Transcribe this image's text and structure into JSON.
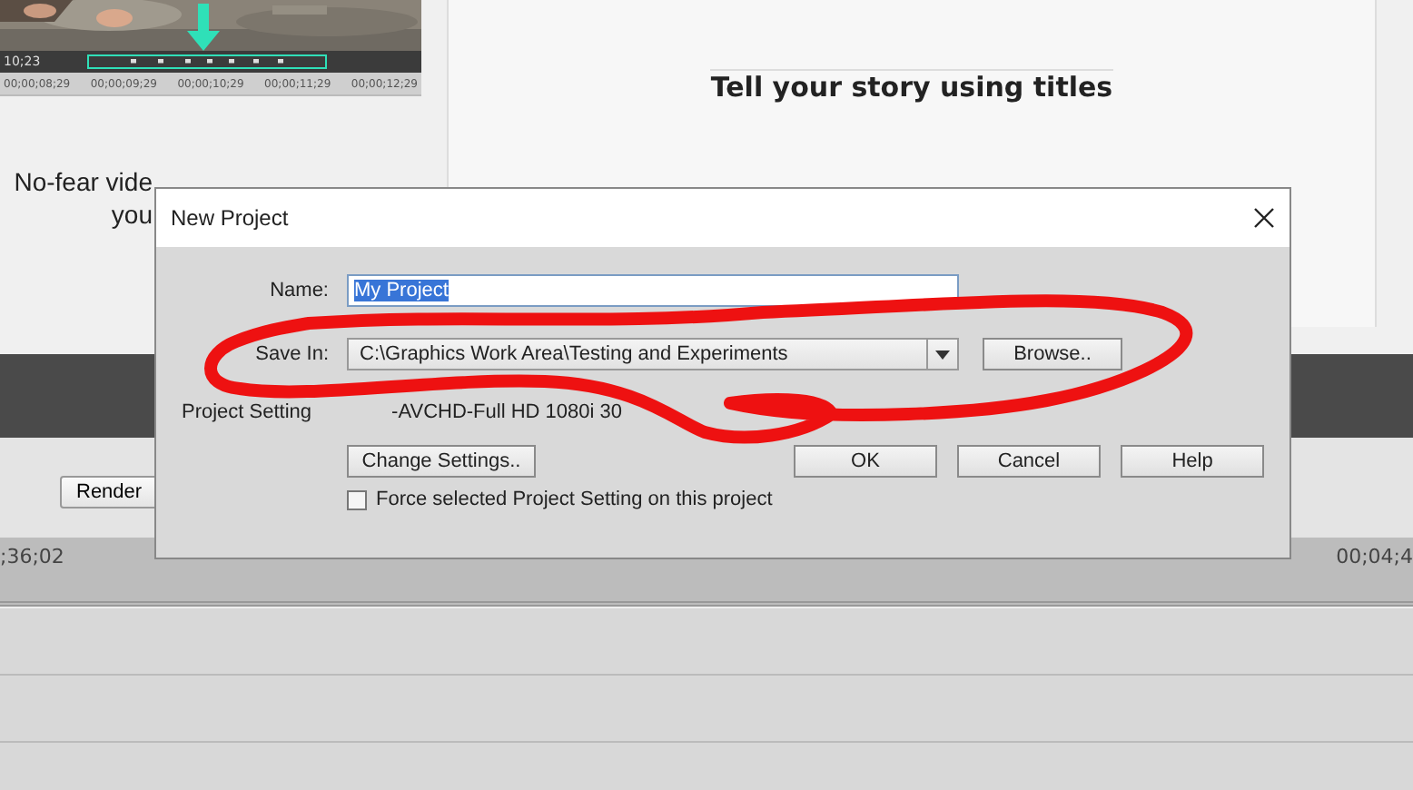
{
  "video_preview": {
    "timecode": "10;23",
    "timestamps": [
      "00;00;08;29",
      "00;00;09;29",
      "00;00;10;29",
      "00;00;11;29",
      "00;00;12;29"
    ]
  },
  "intro_caption": [
    "No-fear vide",
    "you"
  ],
  "titles_card": {
    "heading": "Tell your story using titles"
  },
  "toolbar": {
    "render_button": "Render"
  },
  "timeline": {
    "start_label": ";36;02",
    "end_label": "00;04;4"
  },
  "dialog": {
    "title": "New Project",
    "name_field": {
      "label": "Name:",
      "value": "My Project",
      "text_selected": true
    },
    "save_in": {
      "label": "Save In:",
      "value": "C:\\Graphics Work Area\\Testing and Experiments",
      "browse_button": "Browse.."
    },
    "project_settings": [
      "Project Setting",
      "-AVCHD-Full HD 1080i 30"
    ],
    "buttons": [
      "Change Settings..",
      "OK",
      "Cancel",
      "Help"
    ],
    "force_checkbox": {
      "label": "Force selected Project Setting on this project",
      "checked": false
    }
  }
}
